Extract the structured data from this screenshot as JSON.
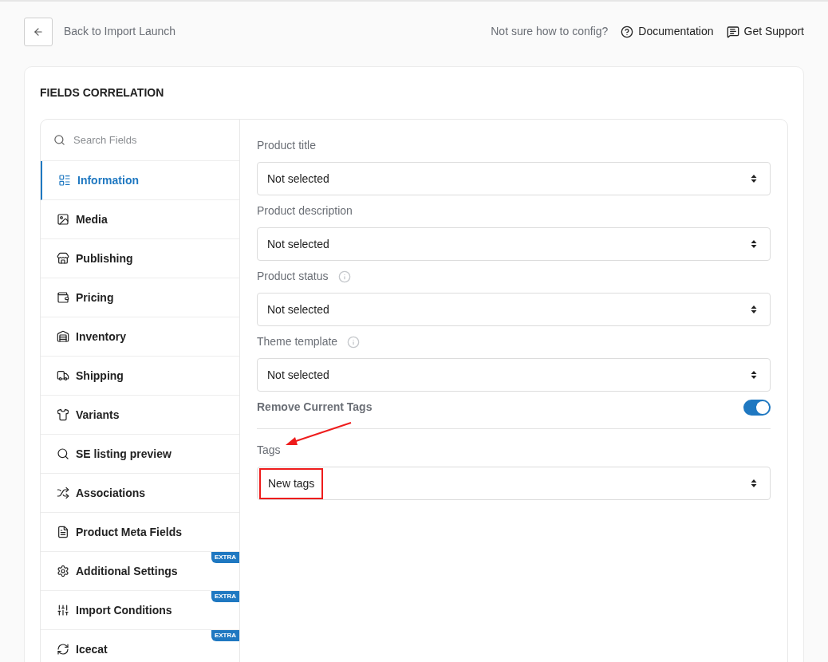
{
  "header": {
    "back_label": "Back to Import Launch",
    "hint": "Not sure how to config?",
    "links": [
      "Documentation",
      "Get Support"
    ]
  },
  "section_title": "FIELDS CORRELATION",
  "search": {
    "placeholder": "Search Fields"
  },
  "sidebar": {
    "items": [
      {
        "label": "Information",
        "selected": true
      },
      {
        "label": "Media",
        "selected": false
      },
      {
        "label": "Publishing",
        "selected": false
      },
      {
        "label": "Pricing",
        "selected": false
      },
      {
        "label": "Inventory",
        "selected": false
      },
      {
        "label": "Shipping",
        "selected": false
      },
      {
        "label": "Variants",
        "selected": false
      },
      {
        "label": "SE listing preview",
        "selected": false
      },
      {
        "label": "Associations",
        "selected": false
      },
      {
        "label": "Product Meta Fields",
        "selected": false
      },
      {
        "label": "Additional Settings",
        "selected": false,
        "badge": "EXTRA"
      },
      {
        "label": "Import Conditions",
        "selected": false,
        "badge": "EXTRA"
      },
      {
        "label": "Icecat",
        "selected": false,
        "badge": "EXTRA"
      }
    ]
  },
  "fields": [
    {
      "kind": "select",
      "label": "Product title",
      "info": false,
      "value": "Not selected"
    },
    {
      "kind": "select",
      "label": "Product description",
      "info": false,
      "value": "Not selected"
    },
    {
      "kind": "select",
      "label": "Product status",
      "info": true,
      "value": "Not selected"
    },
    {
      "kind": "select",
      "label": "Theme template",
      "info": true,
      "value": "Not selected"
    },
    {
      "kind": "toggle",
      "label": "Remove Current Tags",
      "on": true
    },
    {
      "kind": "select",
      "label": "Tags",
      "info": false,
      "value": "New tags",
      "highlighted": true
    }
  ]
}
